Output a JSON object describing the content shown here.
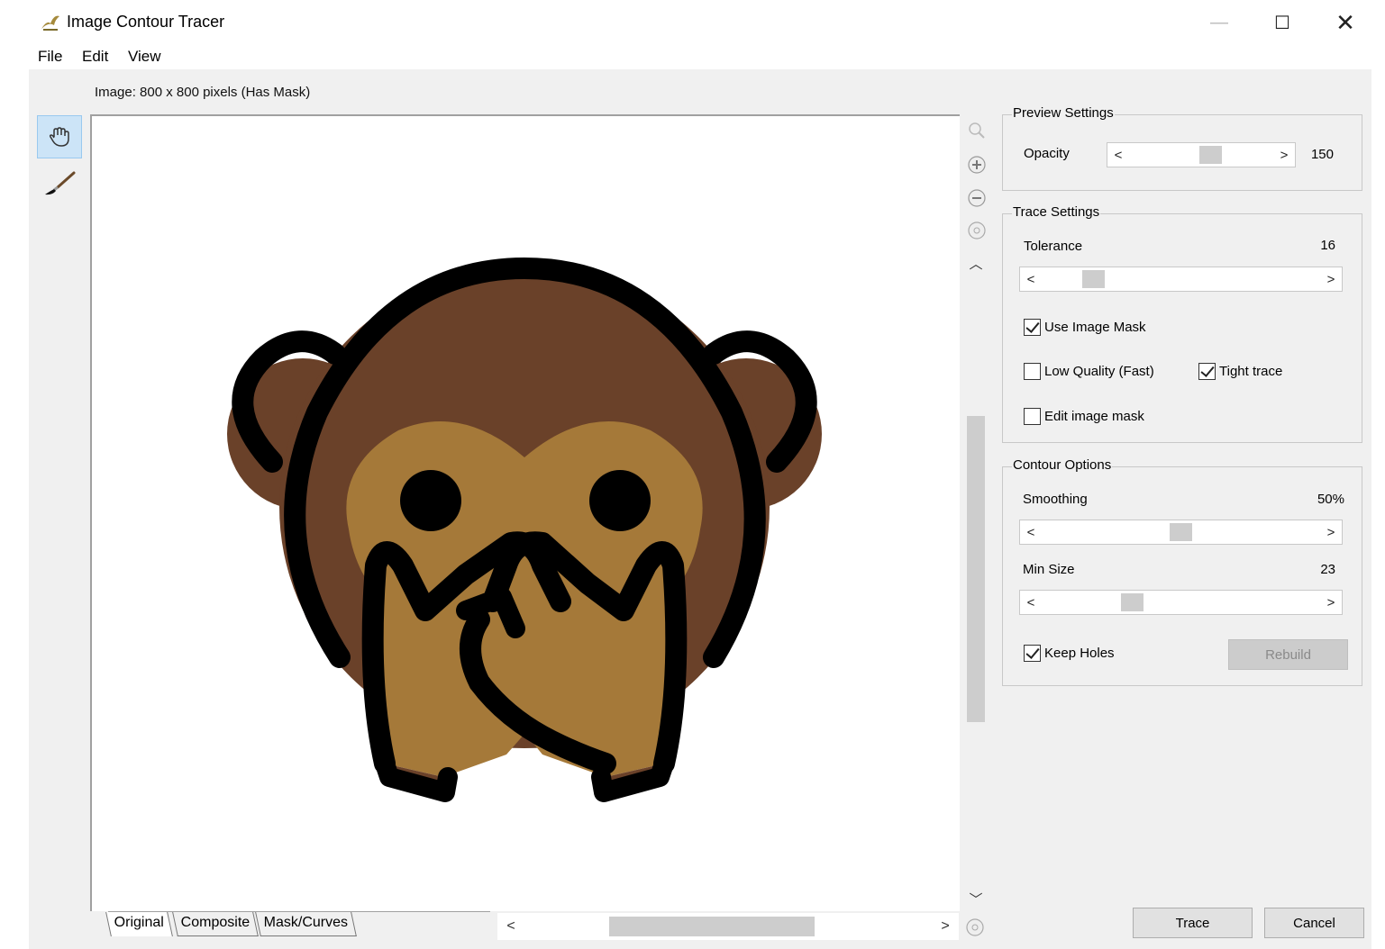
{
  "window": {
    "title": "Image Contour Tracer",
    "minimize_glyph": "—",
    "maximize_glyph": "☐",
    "close_glyph": "✕"
  },
  "menu": [
    "File",
    "Edit",
    "View"
  ],
  "image_info": "Image: 800 x 800 pixels (Has Mask)",
  "tools": [
    {
      "name": "pan-tool",
      "icon": "hand-icon",
      "active": true
    },
    {
      "name": "brush-tool",
      "icon": "brush-icon",
      "active": false
    }
  ],
  "zoom_icons": [
    "zoom-icon",
    "zoom-in-icon",
    "zoom-out-icon",
    "zoom-fit-icon"
  ],
  "tabs": [
    {
      "label": "Original",
      "active": true
    },
    {
      "label": "Composite",
      "active": false
    },
    {
      "label": "Mask/Curves",
      "active": false
    }
  ],
  "preview_settings": {
    "title": "Preview Settings",
    "opacity_label": "Opacity",
    "opacity_value": "150",
    "opacity_fraction": 0.58
  },
  "trace_settings": {
    "title": "Trace Settings",
    "tolerance_label": "Tolerance",
    "tolerance_value": "16",
    "tolerance_fraction": 0.16,
    "use_image_mask": {
      "label": "Use Image Mask",
      "checked": true
    },
    "low_quality": {
      "label": "Low Quality (Fast)",
      "checked": false
    },
    "tight_trace": {
      "label": "Tight trace",
      "checked": true
    },
    "edit_image_mask": {
      "label": "Edit image mask",
      "checked": false
    }
  },
  "contour_options": {
    "title": "Contour Options",
    "smoothing_label": "Smoothing",
    "smoothing_value": "50%",
    "smoothing_fraction": 0.5,
    "min_size_label": "Min Size",
    "min_size_value": "23",
    "min_size_fraction": 0.31,
    "keep_holes": {
      "label": "Keep Holes",
      "checked": true
    },
    "rebuild_label": "Rebuild"
  },
  "buttons": {
    "trace": "Trace",
    "cancel": "Cancel"
  },
  "colors": {
    "monkey_dark": "#6a4129",
    "monkey_light": "#a57939",
    "outline": "#000000",
    "window_bg": "#f0f0f0",
    "accent_active_tool": "#cce4f7"
  }
}
